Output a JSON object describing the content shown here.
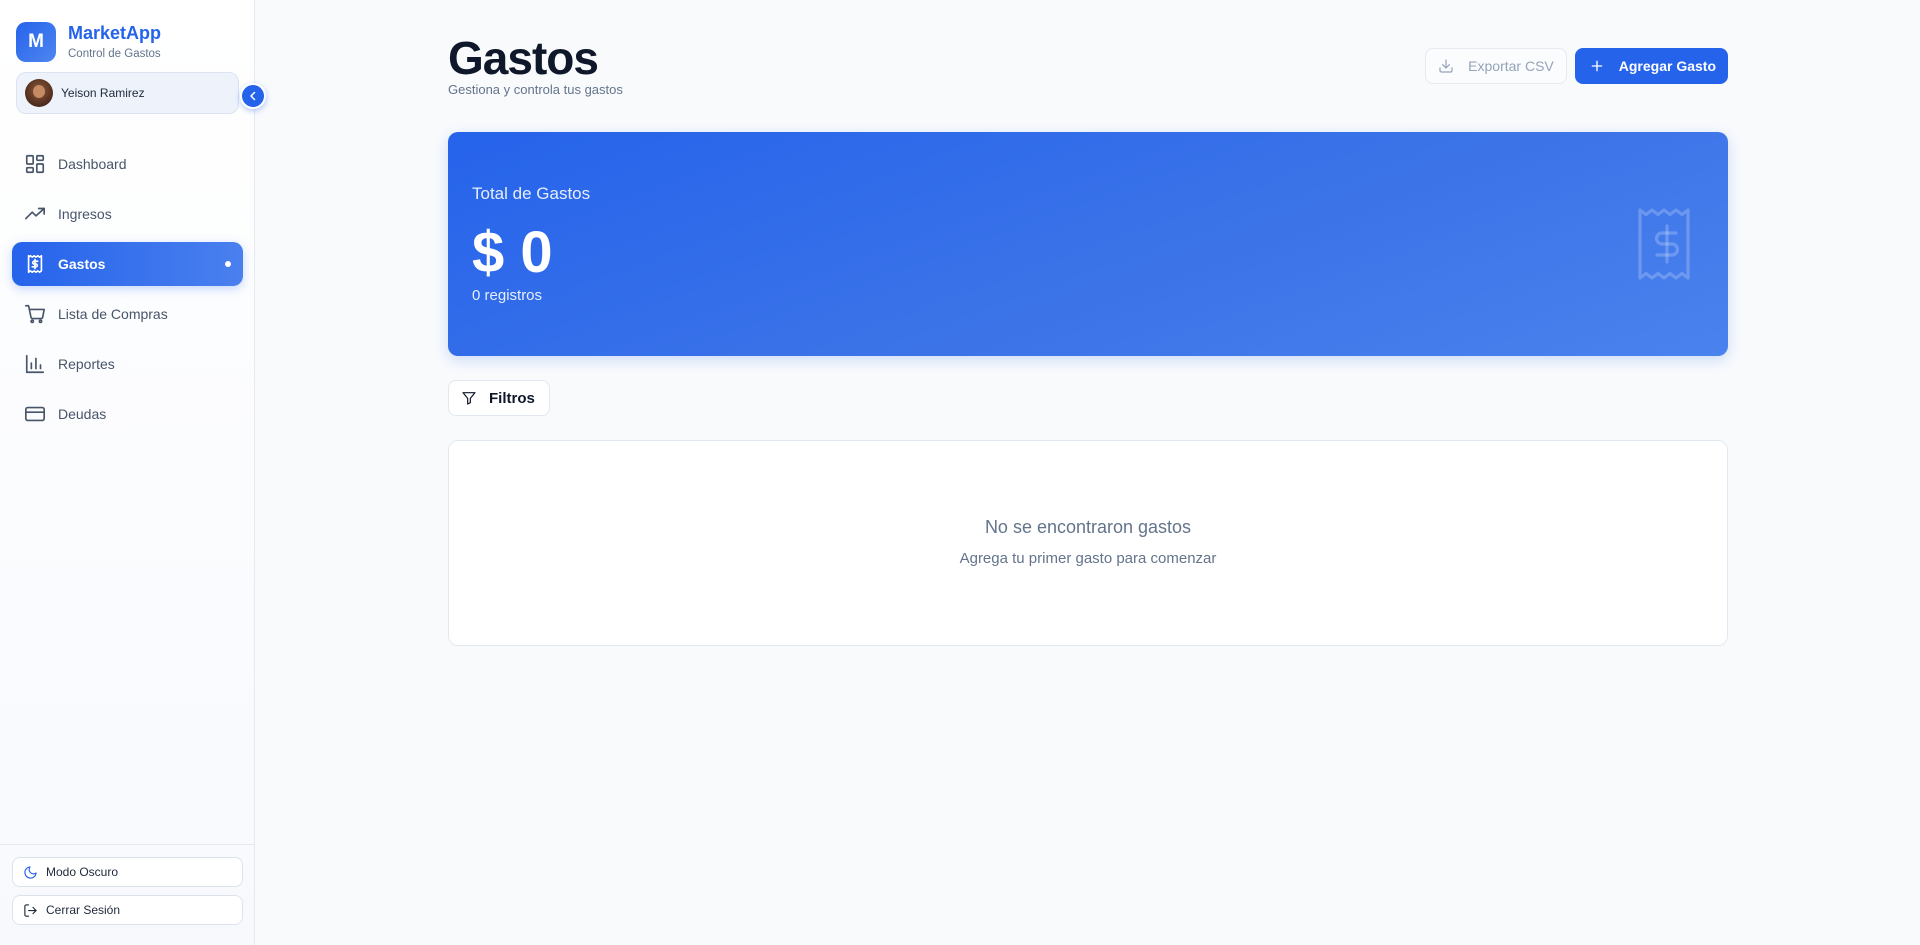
{
  "brand": {
    "logo_letter": "M",
    "name": "MarketApp",
    "subtitle": "Control de Gastos"
  },
  "user": {
    "name": "Yeison Ramirez"
  },
  "sidebar": {
    "items": [
      {
        "label": "Dashboard",
        "icon": "dashboard-icon"
      },
      {
        "label": "Ingresos",
        "icon": "trending-up-icon"
      },
      {
        "label": "Gastos",
        "icon": "receipt-dollar-icon",
        "active": true
      },
      {
        "label": "Lista de Compras",
        "icon": "cart-icon"
      },
      {
        "label": "Reportes",
        "icon": "bar-chart-icon"
      },
      {
        "label": "Deudas",
        "icon": "credit-card-icon"
      }
    ],
    "footer": {
      "dark_mode_label": "Modo Oscuro",
      "logout_label": "Cerrar Sesión"
    }
  },
  "header": {
    "title": "Gastos",
    "subtitle": "Gestiona y controla tus gastos",
    "export_label": "Exportar CSV",
    "add_label": "Agregar Gasto"
  },
  "summary": {
    "label": "Total de Gastos",
    "value": "$ 0",
    "count": "0 registros"
  },
  "filters": {
    "label": "Filtros"
  },
  "empty_state": {
    "title": "No se encontraron gastos",
    "subtitle": "Agrega tu primer gasto para comenzar"
  },
  "colors": {
    "accent": "#2563eb",
    "background": "#f8fafc",
    "text_primary": "#0f172a",
    "text_muted": "#64748b"
  }
}
